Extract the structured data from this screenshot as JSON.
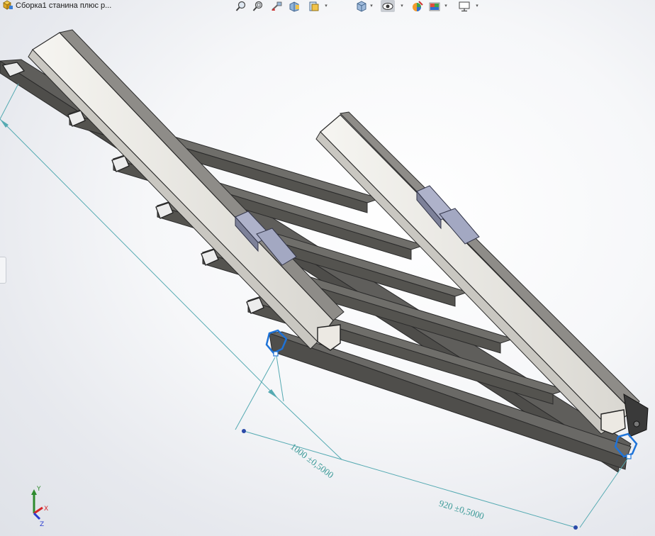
{
  "window": {
    "doc_title": "Сборка1 станина плюс р..."
  },
  "toolbar": {
    "icons": [
      "zoom-to-fit-icon",
      "zoom-to-area-icon",
      "previous-view-icon",
      "section-view-icon",
      "view-orientation-icon",
      "display-style-icon",
      "hide-show-items-icon",
      "edit-appearance-icon",
      "apply-scene-icon",
      "view-settings-icon"
    ]
  },
  "dimensions": {
    "d1": "1000 ±0,5000",
    "d2": "920 ±0,5000"
  },
  "triad": {
    "x": "X",
    "y": "Y",
    "z": "Z"
  },
  "colors": {
    "dimension_line": "#55aab2",
    "selected_edge": "#1e73d8",
    "rail": "#e9e7e2",
    "tube": "#6a6864",
    "carriage": "#a9aec7",
    "triad_x": "#d6262a",
    "triad_y": "#2e8b2e",
    "triad_z": "#2a3bd0"
  }
}
